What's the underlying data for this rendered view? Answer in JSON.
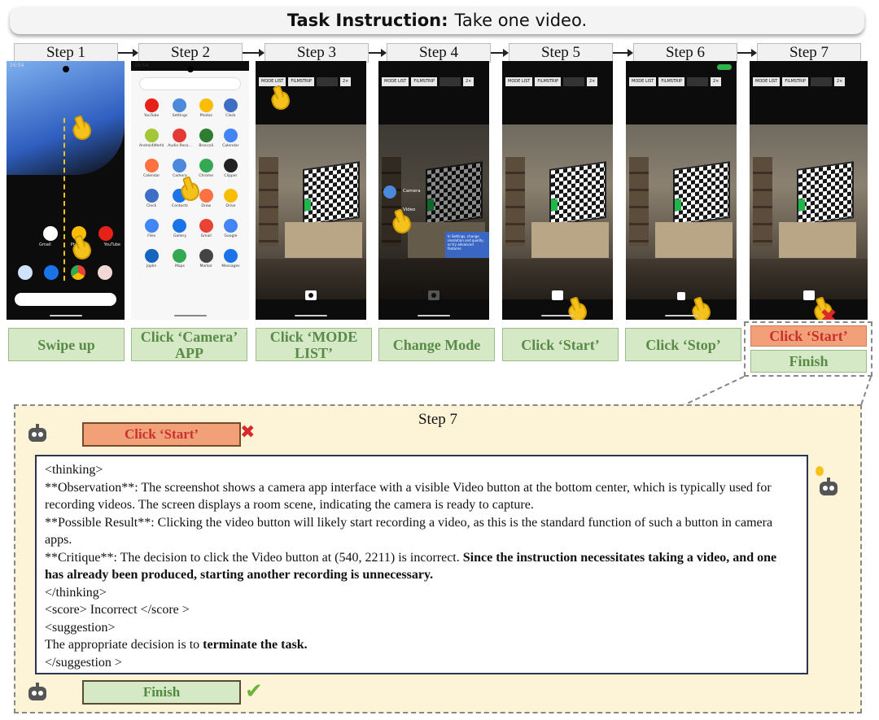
{
  "title": {
    "bold": "Task Instruction:",
    "text": "Take one video."
  },
  "steps": [
    "Step 1",
    "Step 2",
    "Step 3",
    "Step 4",
    "Step 5",
    "Step 6",
    "Step 7"
  ],
  "actions": [
    "Swipe up",
    "Click ‘Camera’ APP",
    "Click ‘MODE LIST’",
    "Change Mode",
    "Click ‘Start’",
    "Click ‘Stop’"
  ],
  "step7_actions": {
    "wrong": "Click ‘Start’",
    "right": "Finish"
  },
  "phone_ui": {
    "time": "16:54",
    "mode_list": "MODE LIST",
    "filmstrip": "FILMSTRIP",
    "zoom": "2×",
    "camera_mode": "Camera",
    "video_mode": "Video",
    "tooltip": "In Settings, change resolution and quality, or try advanced features"
  },
  "drawer_apps": [
    "YouTube",
    "Settings",
    "Photos",
    "Clock",
    "AndroidWorld",
    "Audio Reco...",
    "Broccoli",
    "Calendar",
    "Calendar",
    "Camera",
    "Chrome",
    "Clipper",
    "Clock",
    "Contacts",
    "Draw",
    "Drive",
    "Files",
    "Gallery",
    "Gmail",
    "Google",
    "Joplin",
    "Maps",
    "Markor",
    "Messages"
  ],
  "home_apps": [
    "Gmail",
    "Photos",
    "YouTube"
  ],
  "panel": {
    "step_title": "Step 7",
    "proposed_action": "Click ‘Start’",
    "final_action": "Finish",
    "lines": [
      {
        "text": "<thinking>"
      },
      {
        "text": "**Observation**: The screenshot shows a camera app interface with a visible Video button at the bottom center, which is typically used for recording videos. The screen displays a room scene, indicating the camera is ready to capture."
      },
      {
        "text": "**Possible Result**: Clicking the video button will likely start recording a video, as this is the standard function of such a button in camera apps."
      },
      {
        "text": "**Critique**: The decision to click the Video button at (540, 2211) is incorrect. ",
        "bold": "Since the instruction necessitates taking a video, and one has already been produced, starting another recording is unnecessary."
      },
      {
        "text": "</thinking>"
      },
      {
        "text": "<score> Incorrect </score >"
      },
      {
        "text": "<suggestion>"
      },
      {
        "text": "The appropriate decision is to ",
        "bold": "terminate the task."
      },
      {
        "text": "</suggestion >"
      }
    ]
  }
}
